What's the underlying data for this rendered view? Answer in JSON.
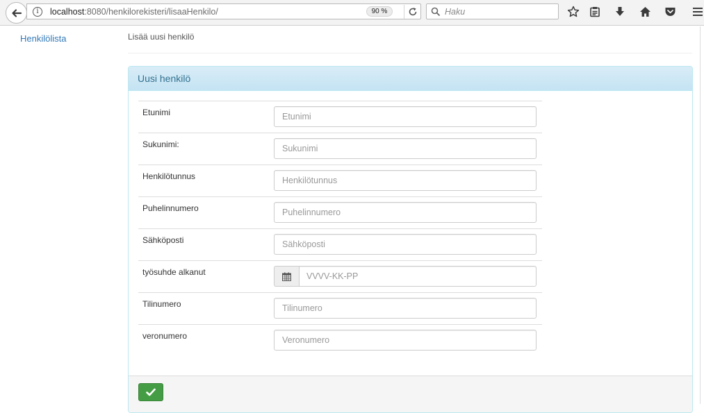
{
  "browser": {
    "url_host": "localhost",
    "url_rest": ":8080/henkilorekisteri/lisaaHenkilo/",
    "zoom": "90 %",
    "search_placeholder": "Haku"
  },
  "sidebar": {
    "link_label": "Henkilölista"
  },
  "breadcrumb": "Lisää uusi henkilö",
  "panel": {
    "title": "Uusi henkilö",
    "fields": [
      {
        "label": "Etunimi",
        "placeholder": "Etunimi"
      },
      {
        "label": "Sukunimi:",
        "placeholder": "Sukunimi"
      },
      {
        "label": "Henkilötunnus",
        "placeholder": "Henkilötunnus"
      },
      {
        "label": "Puhelinnumero",
        "placeholder": "Puhelinnumero"
      },
      {
        "label": "Sähköposti",
        "placeholder": "Sähköposti"
      },
      {
        "label": "työsuhde alkanut",
        "placeholder": "VVVV-KK-PP"
      },
      {
        "label": "Tilinumero",
        "placeholder": "Tilinumero"
      },
      {
        "label": "veronumero",
        "placeholder": "Veronumero"
      }
    ]
  },
  "icons": {
    "back": "back-arrow-icon",
    "info": "info-icon",
    "reload": "reload-icon",
    "search": "search-icon",
    "bookmark": "star-icon",
    "reading_list": "clipboard-icon",
    "downloads": "download-arrow-icon",
    "home": "home-icon",
    "pocket": "pocket-icon",
    "menu": "hamburger-menu-icon",
    "calendar": "calendar-icon",
    "submit": "checkmark-icon"
  },
  "colors": {
    "link": "#337ab7",
    "panel_heading_bg": "#d9edf7",
    "panel_heading_text": "#31708f",
    "submit_bg": "#449d44"
  }
}
